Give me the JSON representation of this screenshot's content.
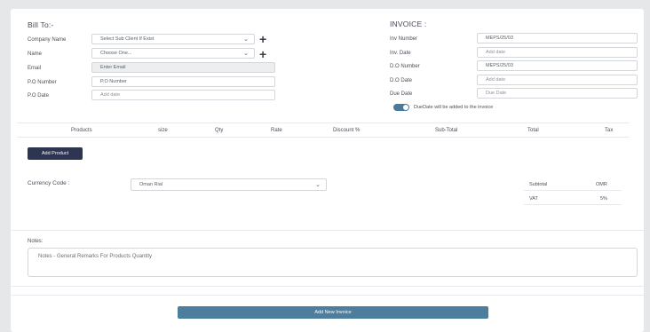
{
  "bill_to": {
    "title": "Bill To:-",
    "company_label": "Company Name",
    "company_value": "Select Sub Client If Exist",
    "name_label": "Name",
    "name_value": "Choose One...",
    "email_label": "Email",
    "email_value": "Enter Email",
    "po_number_label": "P.O Number",
    "po_number_value": "P.O Number",
    "po_date_label": "P.O Date",
    "po_date_placeholder": "Add date"
  },
  "invoice": {
    "title": "INVOICE :",
    "inv_number_label": "Inv Number",
    "inv_number_value": "MEPS/25/03",
    "inv_date_label": "Inv. Date",
    "inv_date_placeholder": "Add date",
    "do_number_label": "D.O Number",
    "do_number_value": "MEPS/25/03",
    "do_date_label": "D.O Date",
    "do_date_placeholder": "Add date",
    "due_date_label": "Due Date",
    "due_date_placeholder": "Due Date",
    "toggle_text": "DueDate will be added to the invoice",
    "toggle_on": true
  },
  "table": {
    "headers": [
      "Products",
      "size",
      "Qty",
      "Rate",
      "Discount %",
      "Sub-Total",
      "Total",
      "Tax"
    ]
  },
  "add_product_label": "Add Product",
  "currency": {
    "label": "Currency Code :",
    "value": "Oman Rial"
  },
  "summary": {
    "subtotal_label": "Subtotal",
    "subtotal_value": "OMR",
    "vat_label": "VAT",
    "vat_value": "5%"
  },
  "notes": {
    "label": "Notes:",
    "value": "Notes - General Remarks For Products Quantity"
  },
  "submit_label": "Add New Invoice",
  "colors": {
    "accent": "#4e7e9e",
    "dark_button": "#2e3550",
    "background": "#e6e7e9"
  }
}
